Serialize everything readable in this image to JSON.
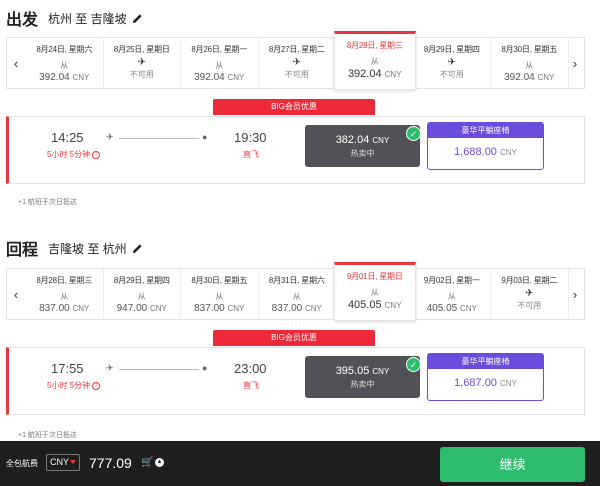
{
  "outbound": {
    "label": "出发",
    "route": "杭州 至 吉隆坡",
    "dates": [
      {
        "date": "8月24日, 星期六",
        "from": "从",
        "price": "392.04",
        "cur": "CNY",
        "available": true
      },
      {
        "date": "8月25日, 星期日",
        "from": "",
        "price": "",
        "cur": "",
        "available": false,
        "na": "不可用"
      },
      {
        "date": "8月26日, 星期一",
        "from": "从",
        "price": "392.04",
        "cur": "CNY",
        "available": true
      },
      {
        "date": "8月27日, 星期二",
        "from": "",
        "price": "",
        "cur": "",
        "available": false,
        "na": "不可用"
      },
      {
        "date": "8月28日, 星期三",
        "from": "从",
        "price": "392.04",
        "cur": "CNY",
        "available": true,
        "selected": true
      },
      {
        "date": "8月29日, 星期四",
        "from": "",
        "price": "",
        "cur": "",
        "available": false,
        "na": "不可用"
      },
      {
        "date": "8月30日, 星期五",
        "from": "从",
        "price": "392.04",
        "cur": "CNY",
        "available": true
      }
    ],
    "badge": "BIG会员优惠",
    "flight": {
      "dep": "14:25",
      "arr": "19:30",
      "duration": "5小时 5分钟",
      "stops": "直飞",
      "fare_price": "382.04",
      "fare_cur": "CNY",
      "fare_sub": "热卖中",
      "premium_title": "豪华平躺座椅",
      "premium_price": "1,688.00",
      "premium_cur": "CNY"
    },
    "note": "+1 航班于次日抵达"
  },
  "inbound": {
    "label": "回程",
    "route": "吉隆坡 至 杭州",
    "dates": [
      {
        "date": "8月28日, 星期三",
        "from": "从",
        "price": "837.00",
        "cur": "CNY",
        "available": true
      },
      {
        "date": "8月29日, 星期四",
        "from": "从",
        "price": "947.00",
        "cur": "CNY",
        "available": true
      },
      {
        "date": "8月30日, 星期五",
        "from": "从",
        "price": "837.00",
        "cur": "CNY",
        "available": true
      },
      {
        "date": "8月31日, 星期六",
        "from": "从",
        "price": "837.00",
        "cur": "CNY",
        "available": true
      },
      {
        "date": "9月01日, 星期日",
        "from": "从",
        "price": "405.05",
        "cur": "CNY",
        "available": true,
        "selected": true
      },
      {
        "date": "9月02日, 星期一",
        "from": "从",
        "price": "405.05",
        "cur": "CNY",
        "available": true
      },
      {
        "date": "9月03日, 星期二",
        "from": "",
        "price": "",
        "cur": "",
        "available": false,
        "na": "不可用"
      }
    ],
    "badge": "BIG会员优惠",
    "flight": {
      "dep": "17:55",
      "arr": "23:00",
      "duration": "5小时 5分钟",
      "stops": "直飞",
      "fare_price": "395.05",
      "fare_cur": "CNY",
      "fare_sub": "热卖中",
      "premium_title": "豪华平躺座椅",
      "premium_price": "1,687.00",
      "premium_cur": "CNY"
    },
    "note": "+1 航班于次日抵达"
  },
  "footer": {
    "label": "全包航费",
    "currency": "CNY",
    "total": "777.09",
    "continue": "继续"
  },
  "colors": {
    "accent_red": "#e8383d",
    "purple": "#6b4bde",
    "green": "#2ebd6e",
    "dark": "#1e1e1e"
  },
  "icons": {
    "edit": "pencil-icon",
    "prev": "chevron-left-icon",
    "next": "chevron-right-icon",
    "plane": "airplane-icon",
    "pin": "location-pin-icon",
    "check": "checkmark-icon",
    "cart": "cart-icon",
    "expand": "chevron-up-icon"
  }
}
